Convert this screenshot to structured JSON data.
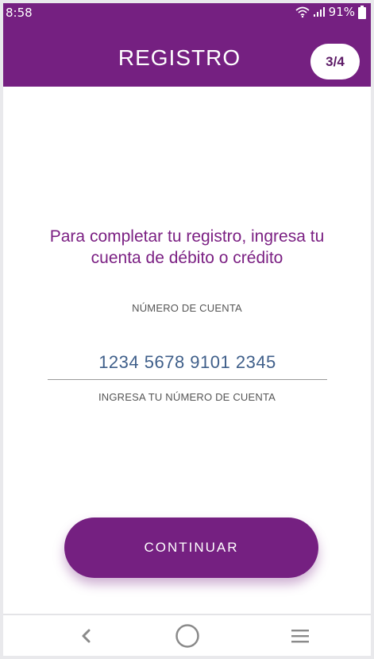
{
  "status_bar": {
    "time": "8:58",
    "battery": "91%",
    "icons": [
      "wifi-icon",
      "signal-icon",
      "battery-icon"
    ]
  },
  "header": {
    "title": "REGISTRO",
    "step": "3/4"
  },
  "form": {
    "instruction": "Para completar tu registro, ingresa tu cuenta de débito o crédito",
    "account_label": "NÚMERO DE CUENTA",
    "account_value": "1234 5678 9101 2345",
    "helper_text": "INGRESA TU NÚMERO DE CUENTA"
  },
  "actions": {
    "continue_label": "CONTINUAR"
  },
  "navigation": {
    "icons": [
      "back-icon",
      "home-icon",
      "menu-icon"
    ]
  },
  "colors": {
    "brand_purple": "#752081",
    "text_purple": "#7b2083",
    "input_text": "#3f5f8a"
  }
}
